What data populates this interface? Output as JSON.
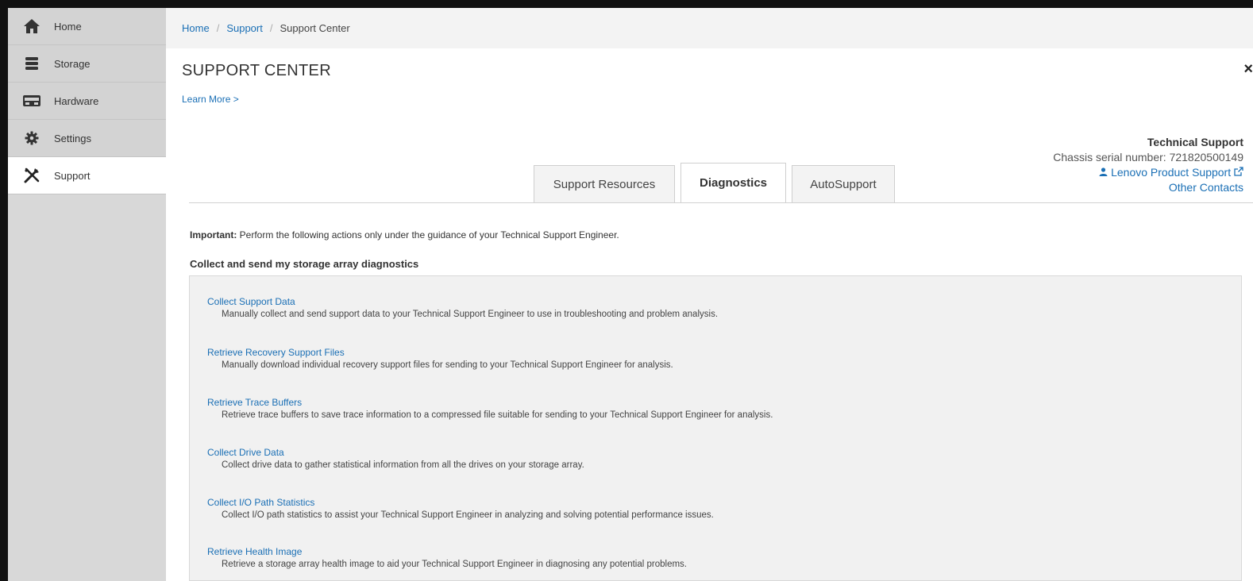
{
  "sidebar": {
    "items": [
      {
        "label": "Home",
        "icon": "home-icon",
        "active": false
      },
      {
        "label": "Storage",
        "icon": "storage-icon",
        "active": false
      },
      {
        "label": "Hardware",
        "icon": "hardware-icon",
        "active": false
      },
      {
        "label": "Settings",
        "icon": "gear-icon",
        "active": false
      },
      {
        "label": "Support",
        "icon": "tools-icon",
        "active": true
      }
    ]
  },
  "breadcrumb": {
    "items": [
      "Home",
      "Support",
      "Support Center"
    ],
    "separator": "/"
  },
  "page": {
    "title": "SUPPORT CENTER",
    "learn_more": "Learn More >",
    "close_glyph": "×"
  },
  "tech_support": {
    "title": "Technical Support",
    "chassis_label": "Chassis serial number:",
    "chassis_serial": "721820500149",
    "product_support": "Lenovo Product Support",
    "other_contacts": "Other Contacts"
  },
  "tabs": [
    {
      "label": "Support Resources",
      "active": false
    },
    {
      "label": "Diagnostics",
      "active": true
    },
    {
      "label": "AutoSupport",
      "active": false
    }
  ],
  "diagnostics": {
    "important_label": "Important:",
    "important_text": "Perform the following actions only under the guidance of your Technical Support Engineer.",
    "section_title": "Collect and send my storage array diagnostics",
    "items": [
      {
        "title": "Collect Support Data",
        "description": "Manually collect and send support data to your Technical Support Engineer to use in troubleshooting and problem analysis."
      },
      {
        "title": "Retrieve Recovery Support Files",
        "description": "Manually download individual recovery support files for sending to your Technical Support Engineer for analysis."
      },
      {
        "title": "Retrieve Trace Buffers",
        "description": "Retrieve trace buffers to save trace information to a compressed file suitable for sending to your Technical Support Engineer for analysis."
      },
      {
        "title": "Collect Drive Data",
        "description": "Collect drive data to gather statistical information from all the drives on your storage array."
      },
      {
        "title": "Collect I/O Path Statistics",
        "description": "Collect I/O path statistics to assist your Technical Support Engineer in analyzing and solving potential performance issues."
      },
      {
        "title": "Retrieve Health Image",
        "description": "Retrieve a storage array health image to aid your Technical Support Engineer in diagnosing any potential problems."
      }
    ]
  },
  "colors": {
    "link": "#1a6fb5",
    "sidebar_bg": "#d3d3d3",
    "panel_bg": "#f1f1f1"
  }
}
